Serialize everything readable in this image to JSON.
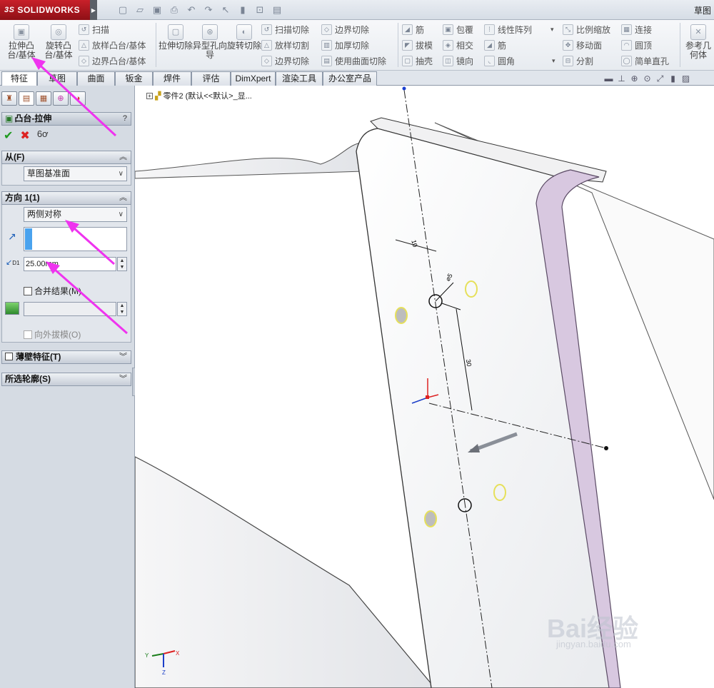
{
  "app": {
    "logo_prefix": "3S",
    "logo_text": "SOLIDWORKS",
    "title_right": "草图"
  },
  "ribbon": {
    "extrude_boss": "拉伸凸台/基体",
    "revolve_boss": "旋转凸台/基体",
    "sweep": "扫描",
    "loft_boss": "放样凸台/基体",
    "boundary_boss": "边界凸台/基体",
    "extrude_cut": "拉伸切除",
    "hole_wizard": "异型孔向导",
    "revolve_cut": "旋转切除",
    "swept_cut": "扫描切除",
    "lofted_cut": "放样切割",
    "boundary_cut": "边界切除",
    "boundary_cut2": "边界切除",
    "thicken_cut": "加厚切除",
    "surface_cut": "使用曲面切除",
    "rib1": "筋",
    "wrap": "包覆",
    "linear_pattern": "线性阵列",
    "draft": "拔模",
    "intersect": "相交",
    "rib2": "筋",
    "shell": "抽壳",
    "mirror": "镜向",
    "fillet": "圆角",
    "scale": "比例缩放",
    "connect": "连接",
    "move_face": "移动面",
    "dome": "圆顶",
    "split": "分割",
    "simple_hole": "简单直孔",
    "ref_geometry": "参考几何体"
  },
  "tabs": [
    "特征",
    "草图",
    "曲面",
    "钣金",
    "焊件",
    "评估",
    "DimXpert",
    "渲染工具",
    "办公室产品"
  ],
  "panel": {
    "title": "凸台-拉伸",
    "help": "?",
    "from_label": "从(F)",
    "from_value": "草图基准面",
    "dir_label": "方向 1(1)",
    "dir_value": "两侧对称",
    "depth_value": "25.00mm",
    "d1": "D1",
    "merge_label": "合并结果(M)",
    "draft_label": "向外拔模(O)",
    "thin_label": "薄壁特征(T)",
    "contours_label": "所选轮廓(S)"
  },
  "viewport": {
    "crumb": "零件2 (默认<<默认>_显...",
    "dim_10": "10",
    "dim_dia": "⌀5",
    "dim_30": "30",
    "watermark": "Bai经验",
    "watermark_url": "jingyan.baidu.com",
    "axis_x": "X",
    "axis_y": "Y",
    "axis_z": "Z"
  }
}
